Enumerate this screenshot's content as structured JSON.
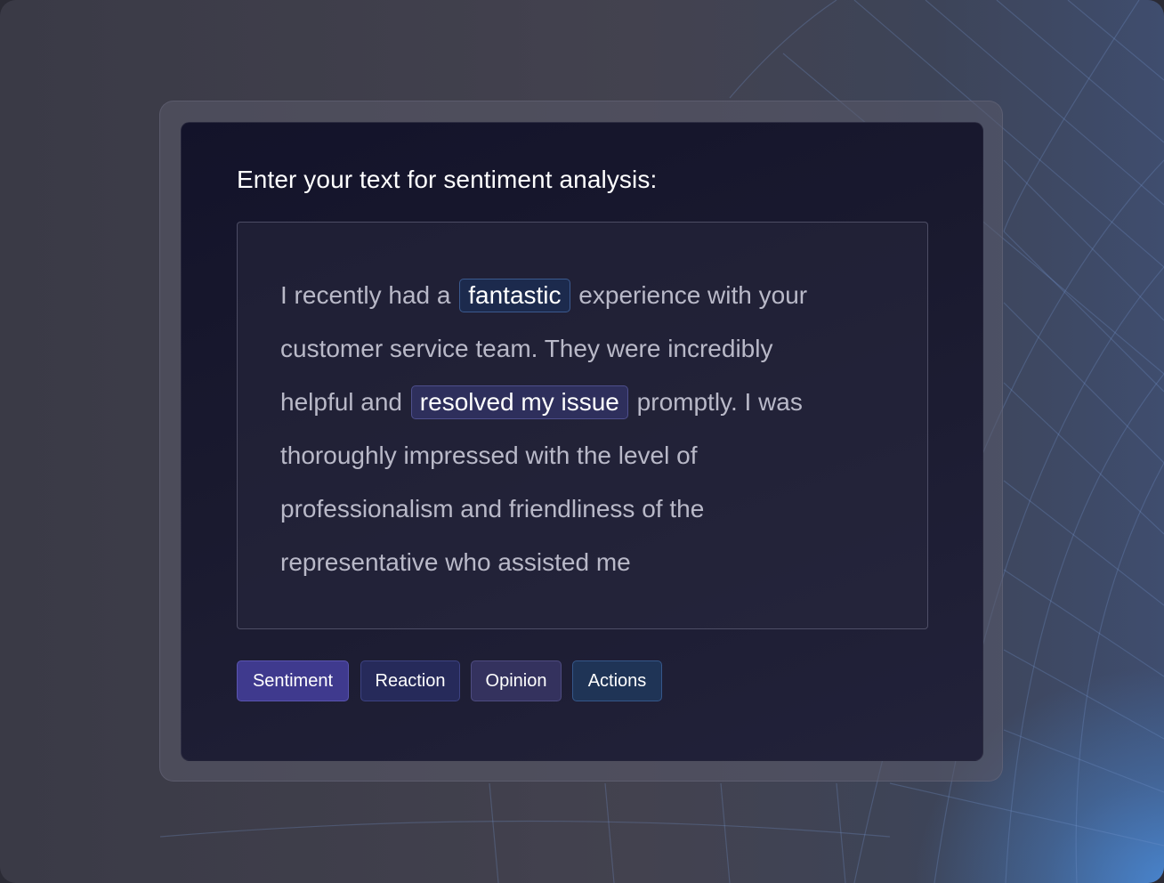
{
  "prompt": {
    "heading": "Enter your text for sentiment analysis:"
  },
  "input_text": {
    "lines": [
      {
        "before": "I recently had a ",
        "highlight": "fantastic",
        "after": " experience with your"
      },
      {
        "text": "customer service team. They were incredibly"
      },
      {
        "before": "helpful and ",
        "highlight": "resolved my issue",
        "after": " promptly. I was"
      },
      {
        "text": "thoroughly impressed with the level of"
      },
      {
        "text": "professionalism and friendliness of the"
      },
      {
        "text": "representative who assisted me"
      }
    ]
  },
  "tags": {
    "sentiment": "Sentiment",
    "reaction": "Reaction",
    "opinion": "Opinion",
    "actions": "Actions"
  },
  "colors": {
    "highlight_positive": "#1c2a4d",
    "highlight_resolved": "#2e2f5c",
    "tag_sentiment": "#3f3a8e",
    "tag_reaction": "#262a5a",
    "tag_opinion": "#34325e",
    "tag_actions": "#1f3456",
    "accent_glow": "#4a90e2"
  }
}
